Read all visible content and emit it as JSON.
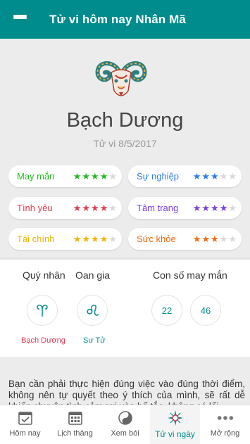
{
  "appbar": {
    "title": "Tử vi hôm nay Nhân Mã",
    "menu_icon": "hamburger-menu-icon"
  },
  "colors": {
    "primary": "#008c8c",
    "green": "#22bb22",
    "red": "#e63950",
    "yellow": "#f2b200",
    "blue": "#2a7ef0",
    "purple": "#7a3ce0",
    "orange": "#f06a10",
    "empty_star": "#d8d8d8"
  },
  "hero": {
    "sign_icon": "aries-ram-illustration",
    "sign_name": "Bạch Dương",
    "date_text": "Tử vi 8/5/2017"
  },
  "ratings": [
    {
      "label": "May mắn",
      "stars": 4,
      "max": 5,
      "color": "#22bb22"
    },
    {
      "label": "Sự nghiệp",
      "stars": 3,
      "max": 5,
      "color": "#2a7ef0"
    },
    {
      "label": "Tình yêu",
      "stars": 4,
      "max": 5,
      "color": "#e63950"
    },
    {
      "label": "Tâm trạng",
      "stars": 4,
      "max": 5,
      "color": "#7a3ce0"
    },
    {
      "label": "Tài chính",
      "stars": 4,
      "max": 5,
      "color": "#f2b200"
    },
    {
      "label": "Sức khỏe",
      "stars": 3,
      "max": 5,
      "color": "#f06a10"
    }
  ],
  "relations": {
    "quy_nhan_title": "Quý nhân",
    "oan_gia_title": "Oan gia",
    "lucky_title": "Con số may mắn",
    "quy_nhan_sign": "Bạch Dương",
    "oan_gia_sign": "Sư Tử",
    "quy_nhan_icon": "aries-symbol-icon",
    "oan_gia_icon": "leo-symbol-icon",
    "lucky_numbers": [
      "22",
      "46"
    ]
  },
  "description": "Bạn cần phải thực hiện đúng việc vào đúng thời điểm, không nên tự quyết theo ý thích của mình, sẽ rất dễ khiến chuyện tình cảm rơi vào bế tắc, không có lối",
  "tabs": [
    {
      "label": "Hôm nay",
      "icon": "calendar-check-icon",
      "active": false
    },
    {
      "label": "Lịch tháng",
      "icon": "calendar-grid-icon",
      "active": false
    },
    {
      "label": "Xem bói",
      "icon": "yin-yang-icon",
      "active": false
    },
    {
      "label": "Tử vi ngày",
      "icon": "compass-star-icon",
      "active": true
    },
    {
      "label": "Mở rộng",
      "icon": "more-dots-icon",
      "active": false
    }
  ]
}
